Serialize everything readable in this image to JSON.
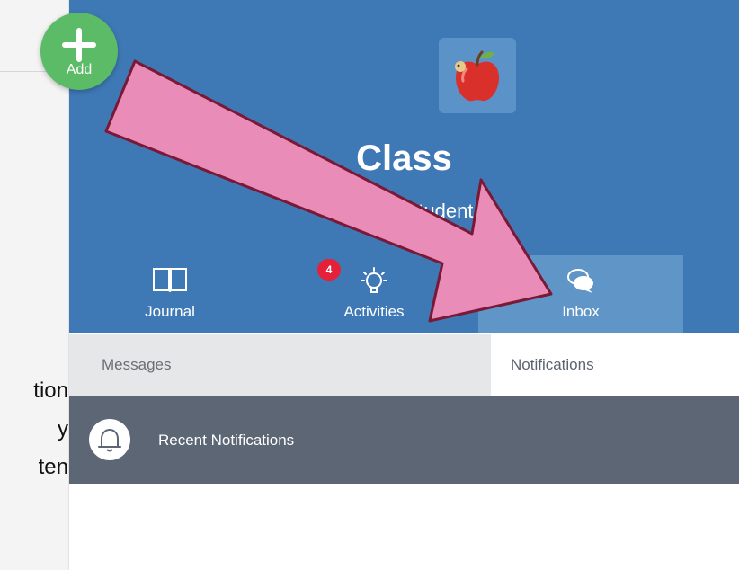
{
  "left_panel": {
    "fragments": [
      "tion",
      "y",
      "ten"
    ]
  },
  "add_button": {
    "label": "Add"
  },
  "header": {
    "class_icon": "apple-icon",
    "title": "Class",
    "subtitle": "Student"
  },
  "nav": {
    "items": [
      {
        "label": "Journal",
        "icon": "book-icon"
      },
      {
        "label": "Activities",
        "icon": "lightbulb-icon",
        "badge": "4"
      },
      {
        "label": "Inbox",
        "icon": "chat-bubbles-icon",
        "active": true
      }
    ]
  },
  "inbox": {
    "tabs": [
      {
        "label": "Messages"
      },
      {
        "label": "Notifications",
        "active": true
      }
    ],
    "section_title": "Recent Notifications"
  },
  "colors": {
    "header_blue": "#3e79b6",
    "active_tab_blue": "#6095c7",
    "add_green": "#5cbb66",
    "badge_red": "#e5213a",
    "notif_bar": "#5c6674",
    "annotation_arrow": "#e98cb8"
  }
}
